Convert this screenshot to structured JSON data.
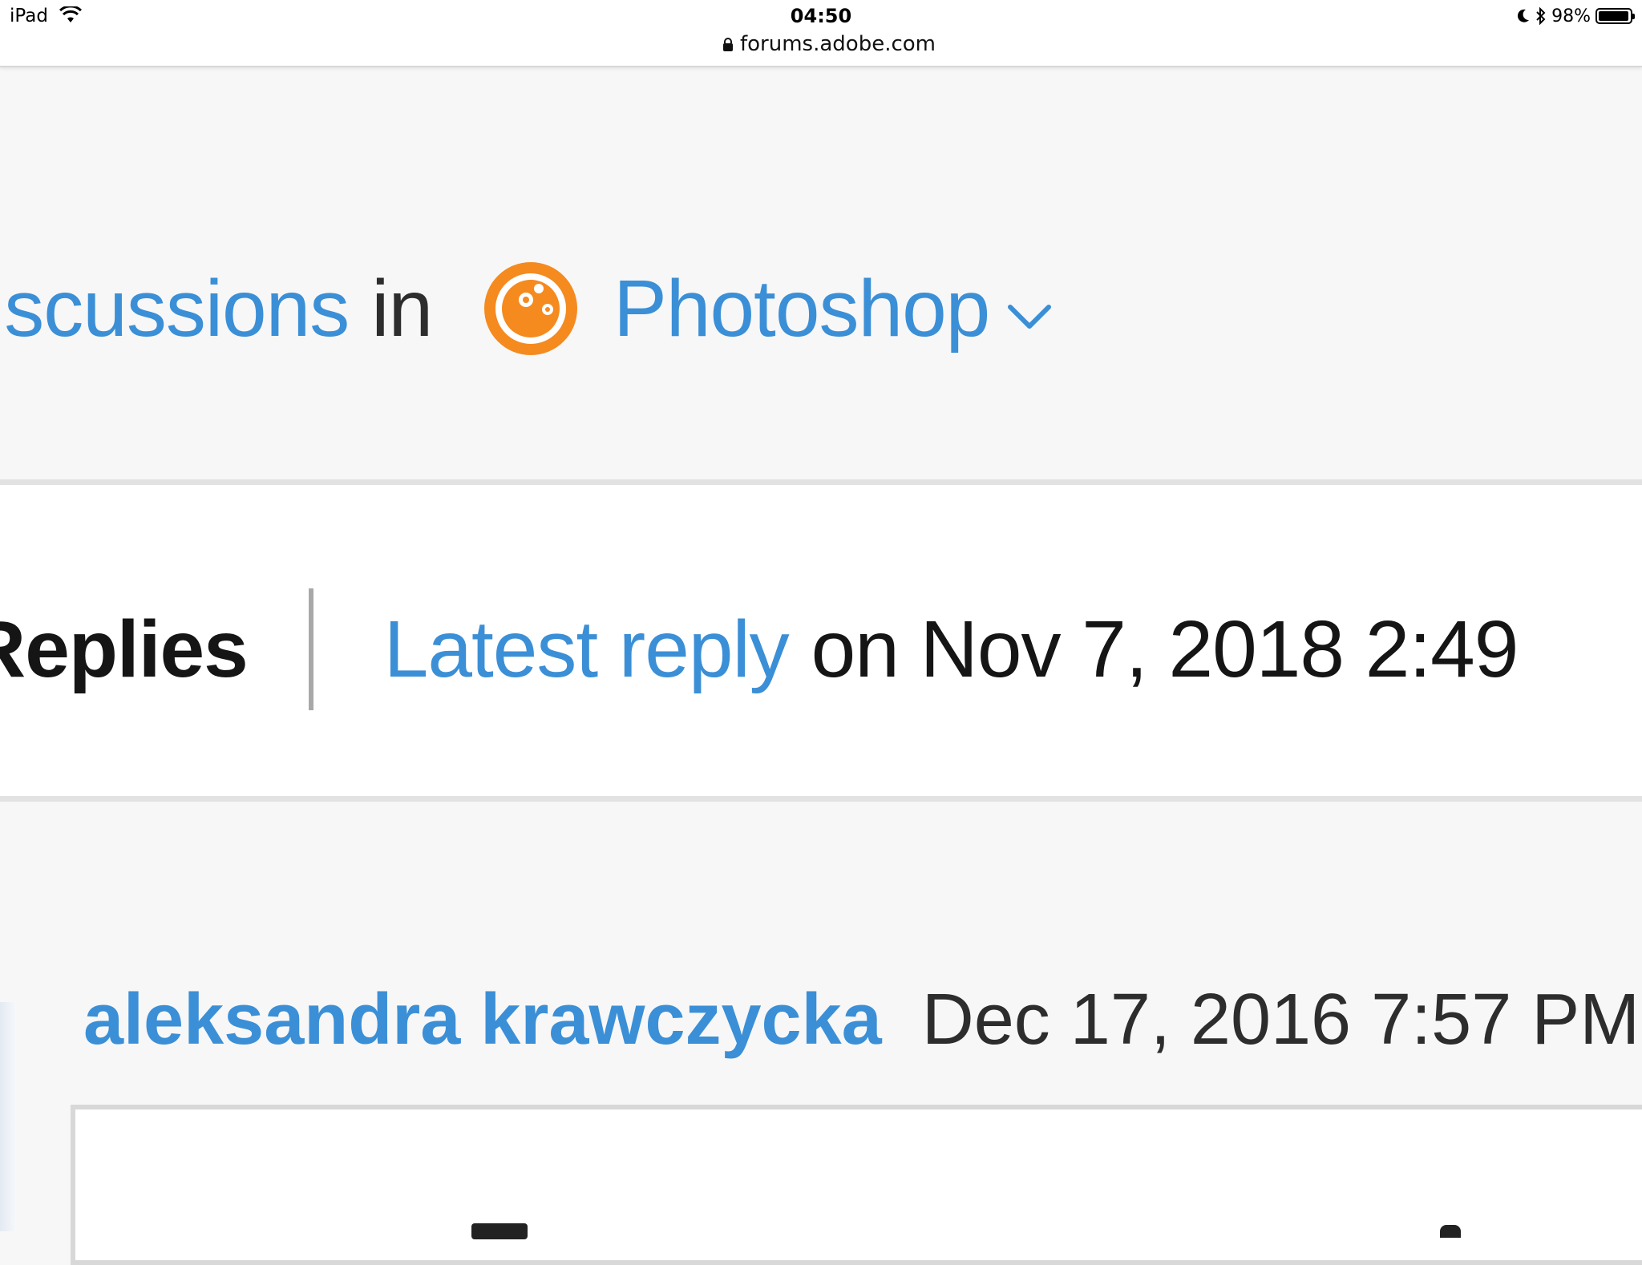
{
  "status_bar": {
    "device": "iPad",
    "time": "04:50",
    "url": "forums.adobe.com",
    "battery_text": "98%",
    "battery_level": 0.98,
    "icons": [
      "wifi-icon",
      "lock-icon",
      "moon-icon",
      "bluetooth-icon",
      "battery-icon"
    ]
  },
  "place": {
    "link_text": "iscussions",
    "connector": "in",
    "product_name": "Photoshop",
    "product_icon": "photoshop-orange-icon",
    "dropdown_icon": "chevron-down-icon"
  },
  "thread_meta": {
    "replies_label": "Replies",
    "latest_reply_link": "Latest reply",
    "latest_reply_rest": "on Nov 7, 2018 2:49"
  },
  "reply": {
    "author": "aleksandra krawczycka",
    "date": "Dec 17, 2016 7:57 PM"
  },
  "colors": {
    "link": "#3b8fd6",
    "text": "#151515",
    "background": "#f7f7f7",
    "photoshop_orange": "#f58a1f"
  }
}
